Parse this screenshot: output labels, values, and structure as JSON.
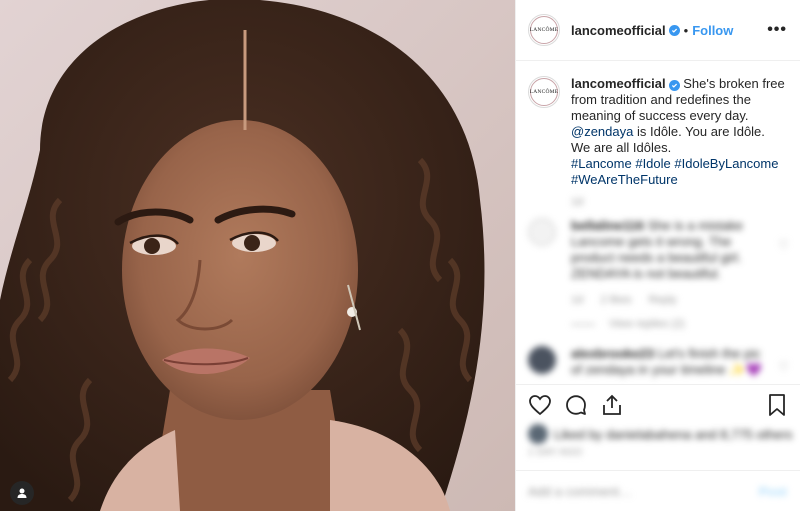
{
  "header": {
    "avatar_label": "LANCÔME",
    "username": "lancomeofficial",
    "separator": "•",
    "follow_label": "Follow",
    "more_label": "•••"
  },
  "caption": {
    "username": "lancomeofficial",
    "line1": " She's broken free from tradition and redefines the meaning of success every day.",
    "mention": "@zendaya",
    "line2": " is Idôle. You are Idôle. We are all Idôles.",
    "hashtags": [
      "#Lancome",
      "#Idole",
      "#IdoleByLancome",
      "#WeAreTheFuture"
    ],
    "time": "1d"
  },
  "comments": [
    {
      "username": "bellaline116",
      "text": "She is a mistake Lancome gets it wrong. The product needs a beautiful girl. ZENDAYA is not beautiful.",
      "time": "1d",
      "likes": "2 likes",
      "reply_label": "Reply",
      "view_replies": "View replies (2)"
    },
    {
      "username": "alexbrooke23",
      "text": "Let's finish the pic of zendaya in your timeline ✨💜",
      "time": "",
      "likes": "",
      "reply_label": "",
      "view_replies": ""
    }
  ],
  "likes_text": "Liked by danielabahena and 8,775 others",
  "post_time": "1 DAY AGO",
  "add_comment": {
    "placeholder": "Add a comment…",
    "post_label": "Post"
  },
  "colors": {
    "accent": "#3897f0",
    "link": "#003569",
    "muted": "#999999",
    "border": "#efefef"
  }
}
